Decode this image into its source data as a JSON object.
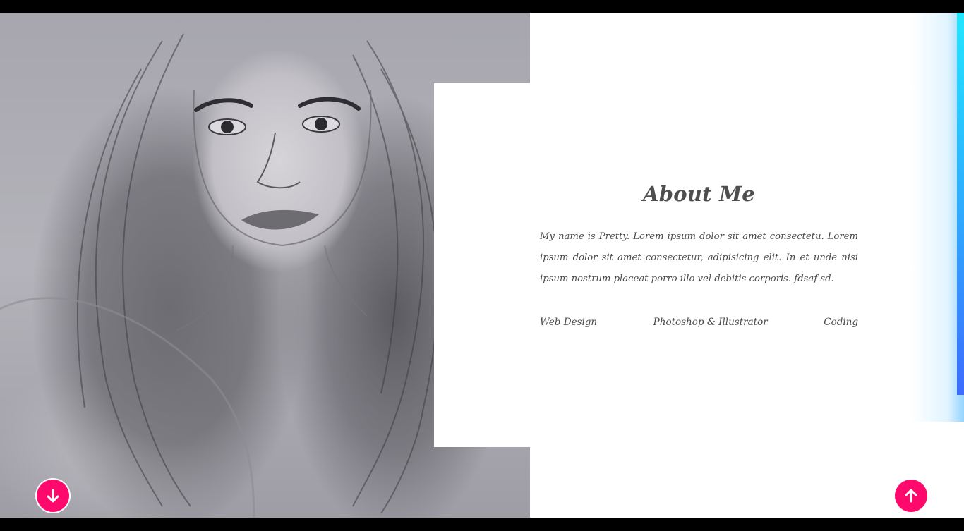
{
  "about": {
    "heading": "About Me",
    "bio": "My name is Pretty. Lorem ipsum dolor sit amet consectetu. Lorem ipsum dolor sit amet consectetur, adipisicing elit. In et unde nisi ipsum nostrum placeat porro illo vel debitis corporis. fdsaf sd.",
    "skills": [
      "Web Design",
      "Photoshop & Illustrator",
      "Coding"
    ]
  },
  "buttons": {
    "scroll_down_icon": "arrow-down-icon",
    "scroll_up_icon": "arrow-up-icon",
    "accent_color": "#ff0a6c"
  },
  "colors": {
    "accent_bar_top": "#22e6ff",
    "accent_bar_bottom": "#3d6bff",
    "text": "#4a4a4a"
  }
}
